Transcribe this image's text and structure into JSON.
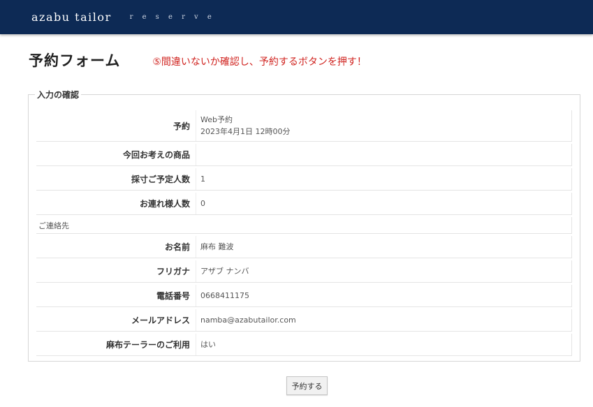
{
  "header": {
    "brand": "azabu tailor",
    "subtitle": "r e s e r v e"
  },
  "page": {
    "title": "予約フォーム",
    "instruction": "⑤間違いないか確認し、予約するボタンを押す！"
  },
  "confirm": {
    "legend": "入力の確認",
    "rows": [
      {
        "label": "予約",
        "value": "Web予約",
        "value2": "2023年4月1日 12時00分"
      },
      {
        "label": "今回お考えの商品",
        "value": ""
      },
      {
        "label": "採寸ご予定人数",
        "value": "1"
      },
      {
        "label": "お連れ様人数",
        "value": "0"
      },
      {
        "section": "ご連絡先"
      },
      {
        "label": "お名前",
        "value": "麻布 難波"
      },
      {
        "label": "フリガナ",
        "value": "アザブ ナンバ"
      },
      {
        "label": "電話番号",
        "value": "0668411175"
      },
      {
        "label": "メールアドレス",
        "value": "namba@azabutailor.com"
      },
      {
        "label": "麻布テーラーのご利用",
        "value": "はい"
      }
    ]
  },
  "submit": {
    "label": "予約する"
  }
}
